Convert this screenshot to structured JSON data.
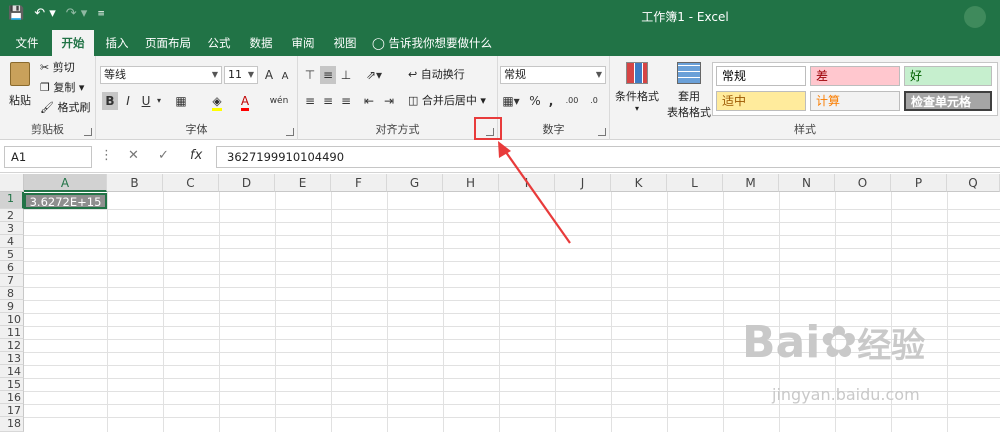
{
  "window": {
    "title": "工作簿1  -  Excel"
  },
  "tabs": [
    "文件",
    "开始",
    "插入",
    "页面布局",
    "公式",
    "数据",
    "审阅",
    "视图"
  ],
  "active_tab": "开始",
  "tell_me": "告诉我你想要做什么",
  "clipboard": {
    "paste": "粘贴",
    "cut": "剪切",
    "copy": "复制",
    "format_painter": "格式刷",
    "group": "剪贴板"
  },
  "font": {
    "name": "等线",
    "size": "11",
    "bold": "B",
    "italic": "I",
    "underline": "U",
    "group": "字体",
    "grow": "A",
    "shrink": "A",
    "wen": "wén"
  },
  "alignment": {
    "wrap": "自动换行",
    "merge": "合并后居中",
    "group": "对齐方式"
  },
  "number": {
    "format": "常规",
    "percent": "%",
    "comma": ",",
    "group": "数字"
  },
  "styles": {
    "conditional": "条件格式",
    "table": "套用",
    "table2": "表格格式",
    "group": "样式",
    "cells": [
      {
        "label": "常规",
        "bg": "#ffffff",
        "fg": "#000000"
      },
      {
        "label": "差",
        "bg": "#ffc7ce",
        "fg": "#9c0006"
      },
      {
        "label": "好",
        "bg": "#c6efce",
        "fg": "#006100"
      },
      {
        "label": "适中",
        "bg": "#ffeb9c",
        "fg": "#9c5700"
      },
      {
        "label": "计算",
        "bg": "#f2f2f2",
        "fg": "#fa7d00"
      },
      {
        "label": "检查单元格",
        "bg": "#a5a5a5",
        "fg": "#ffffff"
      }
    ]
  },
  "formula_bar": {
    "name_box": "A1",
    "fx": "fx",
    "value": "3627199910104490"
  },
  "columns": [
    "A",
    "B",
    "C",
    "D",
    "E",
    "F",
    "G",
    "H",
    "I",
    "J",
    "K",
    "L",
    "M",
    "N",
    "O",
    "P",
    "Q"
  ],
  "rows": [
    "1",
    "2",
    "3",
    "4",
    "5",
    "6",
    "7",
    "8",
    "9",
    "10",
    "11",
    "12",
    "13",
    "14",
    "15",
    "16",
    "17",
    "18"
  ],
  "cell_a1": "3.6272E+15",
  "watermark": {
    "brand": "Bai",
    "brand2": "经验",
    "url": "jingyan.baidu.com"
  },
  "colors": {
    "excel_green": "#217346",
    "annotation_red": "#e83b3b"
  }
}
